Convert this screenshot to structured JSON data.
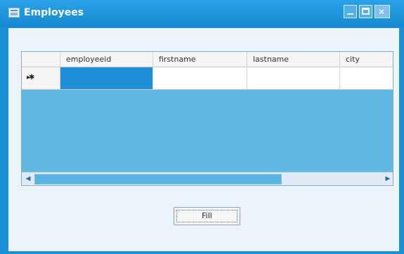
{
  "window": {
    "title": "Employees",
    "controls": {
      "minimize": "minimize",
      "maximize": "maximize",
      "close": "close"
    }
  },
  "grid": {
    "columns": [
      "employeeid",
      "firstname",
      "lastname",
      "city"
    ],
    "new_row_marker": "▸✱",
    "scroll": {
      "left_arrow": "◀",
      "right_arrow": "▶"
    }
  },
  "buttons": {
    "fill": "Fill"
  }
}
